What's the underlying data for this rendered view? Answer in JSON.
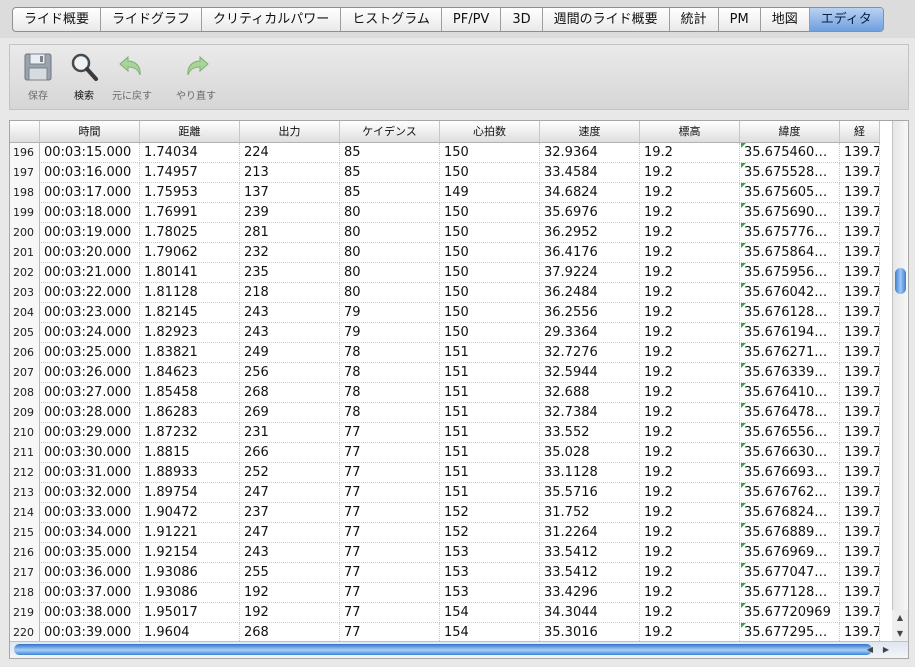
{
  "tabs": [
    {
      "label": "ライド概要",
      "active": false
    },
    {
      "label": "ライドグラフ",
      "active": false
    },
    {
      "label": "クリティカルパワー",
      "active": false
    },
    {
      "label": "ヒストグラム",
      "active": false
    },
    {
      "label": "PF/PV",
      "active": false
    },
    {
      "label": "3D",
      "active": false
    },
    {
      "label": "週間のライド概要",
      "active": false
    },
    {
      "label": "統計",
      "active": false
    },
    {
      "label": "PM",
      "active": false
    },
    {
      "label": "地図",
      "active": false
    },
    {
      "label": "エディタ",
      "active": true
    }
  ],
  "toolbar": {
    "save": {
      "label": "保存",
      "icon": "floppy-disk-icon",
      "enabled": false
    },
    "search": {
      "label": "検索",
      "icon": "magnifier-icon",
      "enabled": true
    },
    "undo": {
      "label": "元に戻す",
      "icon": "undo-arrow-icon",
      "enabled": false
    },
    "redo": {
      "label": "やり直す",
      "icon": "redo-arrow-icon",
      "enabled": false
    }
  },
  "table": {
    "columns": [
      "",
      "時間",
      "距離",
      "出力",
      "ケイデンス",
      "心拍数",
      "速度",
      "標高",
      "緯度",
      "経"
    ],
    "rows": [
      [
        "196",
        "00:03:15.000",
        "1.74034",
        "224",
        "85",
        "150",
        "32.9364",
        "19.2",
        "35.675460…",
        "139.7"
      ],
      [
        "197",
        "00:03:16.000",
        "1.74957",
        "213",
        "85",
        "150",
        "33.4584",
        "19.2",
        "35.675528…",
        "139.7"
      ],
      [
        "198",
        "00:03:17.000",
        "1.75953",
        "137",
        "85",
        "149",
        "34.6824",
        "19.2",
        "35.675605…",
        "139.7"
      ],
      [
        "199",
        "00:03:18.000",
        "1.76991",
        "239",
        "80",
        "150",
        "35.6976",
        "19.2",
        "35.675690…",
        "139.7"
      ],
      [
        "200",
        "00:03:19.000",
        "1.78025",
        "281",
        "80",
        "150",
        "36.2952",
        "19.2",
        "35.675776…",
        "139.7"
      ],
      [
        "201",
        "00:03:20.000",
        "1.79062",
        "232",
        "80",
        "150",
        "36.4176",
        "19.2",
        "35.675864…",
        "139.7"
      ],
      [
        "202",
        "00:03:21.000",
        "1.80141",
        "235",
        "80",
        "150",
        "37.9224",
        "19.2",
        "35.675956…",
        "139.7"
      ],
      [
        "203",
        "00:03:22.000",
        "1.81128",
        "218",
        "80",
        "150",
        "36.2484",
        "19.2",
        "35.676042…",
        "139.7"
      ],
      [
        "204",
        "00:03:23.000",
        "1.82145",
        "243",
        "79",
        "150",
        "36.2556",
        "19.2",
        "35.676128…",
        "139.7"
      ],
      [
        "205",
        "00:03:24.000",
        "1.82923",
        "243",
        "79",
        "150",
        "29.3364",
        "19.2",
        "35.676194…",
        "139.7"
      ],
      [
        "206",
        "00:03:25.000",
        "1.83821",
        "249",
        "78",
        "151",
        "32.7276",
        "19.2",
        "35.676271…",
        "139.7"
      ],
      [
        "207",
        "00:03:26.000",
        "1.84623",
        "256",
        "78",
        "151",
        "32.5944",
        "19.2",
        "35.676339…",
        "139.7"
      ],
      [
        "208",
        "00:03:27.000",
        "1.85458",
        "268",
        "78",
        "151",
        "32.688",
        "19.2",
        "35.676410…",
        "139.7"
      ],
      [
        "209",
        "00:03:28.000",
        "1.86283",
        "269",
        "78",
        "151",
        "32.7384",
        "19.2",
        "35.676478…",
        "139.7"
      ],
      [
        "210",
        "00:03:29.000",
        "1.87232",
        "231",
        "77",
        "151",
        "33.552",
        "19.2",
        "35.676556…",
        "139.7"
      ],
      [
        "211",
        "00:03:30.000",
        "1.8815",
        "266",
        "77",
        "151",
        "35.028",
        "19.2",
        "35.676630…",
        "139.7"
      ],
      [
        "212",
        "00:03:31.000",
        "1.88933",
        "252",
        "77",
        "151",
        "33.1128",
        "19.2",
        "35.676693…",
        "139.7"
      ],
      [
        "213",
        "00:03:32.000",
        "1.89754",
        "247",
        "77",
        "151",
        "35.5716",
        "19.2",
        "35.676762…",
        "139.7"
      ],
      [
        "214",
        "00:03:33.000",
        "1.90472",
        "237",
        "77",
        "152",
        "31.752",
        "19.2",
        "35.676824…",
        "139.7"
      ],
      [
        "215",
        "00:03:34.000",
        "1.91221",
        "247",
        "77",
        "152",
        "31.2264",
        "19.2",
        "35.676889…",
        "139.7"
      ],
      [
        "216",
        "00:03:35.000",
        "1.92154",
        "243",
        "77",
        "153",
        "33.5412",
        "19.2",
        "35.676969…",
        "139.7"
      ],
      [
        "217",
        "00:03:36.000",
        "1.93086",
        "255",
        "77",
        "153",
        "33.5412",
        "19.2",
        "35.677047…",
        "139.7"
      ],
      [
        "218",
        "00:03:37.000",
        "1.93086",
        "192",
        "77",
        "153",
        "33.4296",
        "19.2",
        "35.677128…",
        "139.7"
      ],
      [
        "219",
        "00:03:38.000",
        "1.95017",
        "192",
        "77",
        "154",
        "34.3044",
        "19.2",
        "35.67720969",
        "139.7"
      ],
      [
        "220",
        "00:03:39.000",
        "1.9604",
        "268",
        "77",
        "154",
        "35.3016",
        "19.2",
        "35.677295…",
        "139.7"
      ]
    ]
  },
  "colors": {
    "active_tab": "#6f9fde",
    "lat_marker": "#2fa83b",
    "scroll_thumb": "#3b7fd3"
  }
}
